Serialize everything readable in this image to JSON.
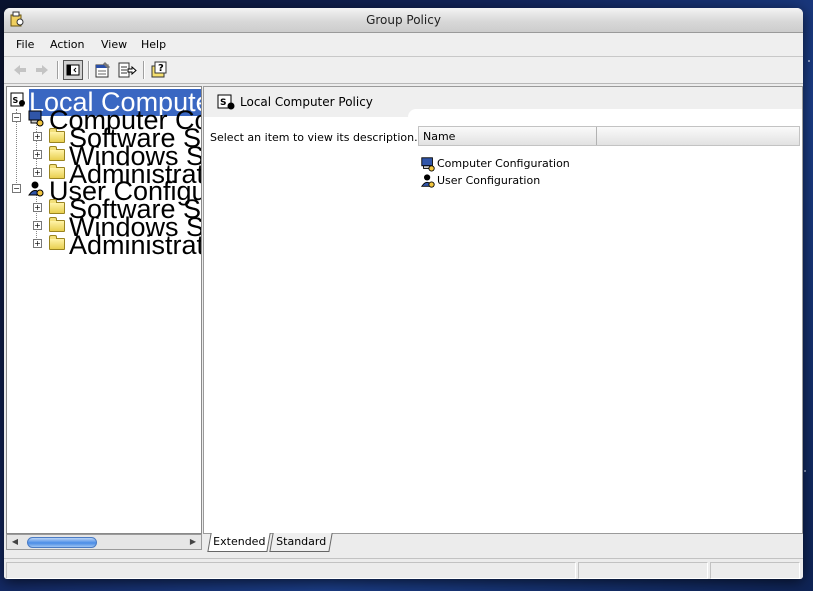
{
  "window": {
    "title": "Group Policy"
  },
  "menu": {
    "items": [
      "File",
      "Action",
      "View",
      "Help"
    ]
  },
  "toolbar": {
    "buttons": [
      "back-arrow-icon",
      "forward-arrow-icon",
      "show-hide-tree-icon",
      "properties-icon",
      "export-list-icon",
      "help-icon"
    ]
  },
  "tree": {
    "root": "Local Computer Policy",
    "nodes": [
      {
        "label": "Computer Configuration",
        "children": [
          "Software Settings",
          "Windows Settings",
          "Administrative Templates"
        ]
      },
      {
        "label": "User Configuration",
        "children": [
          "Software Settings",
          "Windows Settings",
          "Administrative Templates"
        ]
      }
    ]
  },
  "details": {
    "header": "Local Computer Policy",
    "description": "Select an item to view its description.",
    "columns": [
      "Name",
      ""
    ],
    "items": [
      "Computer Configuration",
      "User Configuration"
    ]
  },
  "tabs": [
    "Extended",
    "Standard"
  ],
  "colors": {
    "selection": "#3a67c2",
    "window_bg": "#ececec"
  }
}
